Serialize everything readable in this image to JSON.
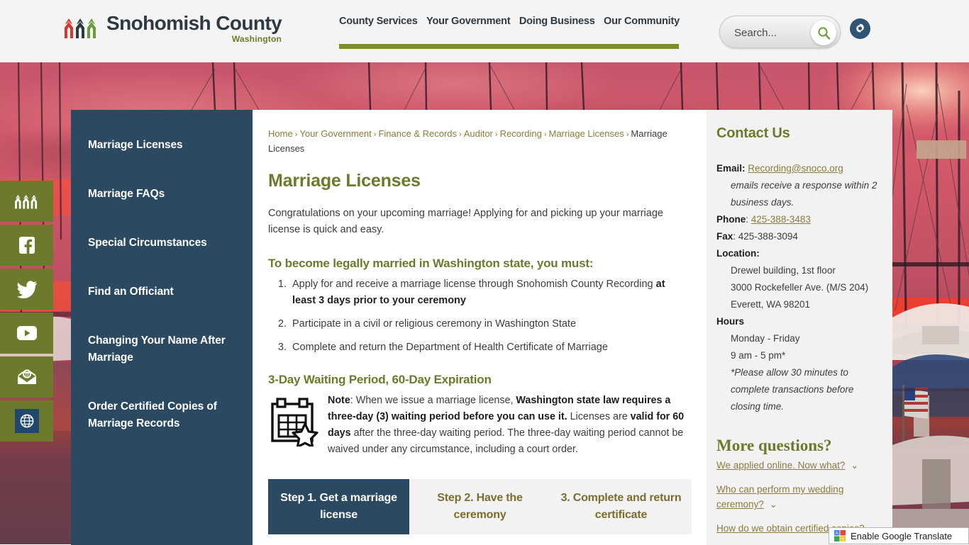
{
  "header": {
    "logo": {
      "title": "Snohomish County",
      "subtitle": "Washington",
      "mark_icon": "three-mountains-logo-icon"
    },
    "nav": [
      {
        "label": "County Services"
      },
      {
        "label": "Your Government"
      },
      {
        "label": "Doing Business"
      },
      {
        "label": "Our Community"
      }
    ],
    "search": {
      "placeholder": "Search...",
      "value": "",
      "icon": "search-icon"
    },
    "settings_icon": "gear-icon",
    "accent_green": "#7d9024"
  },
  "social_rail": [
    {
      "name": "county-logo",
      "icon": "three-mountains-logo-icon"
    },
    {
      "name": "facebook",
      "icon": "facebook-icon"
    },
    {
      "name": "twitter",
      "icon": "twitter-icon"
    },
    {
      "name": "youtube",
      "icon": "youtube-icon"
    },
    {
      "name": "email",
      "icon": "email-envelope-icon"
    },
    {
      "name": "globe",
      "icon": "globe-icon"
    }
  ],
  "sidebar": {
    "items": [
      {
        "label": "Marriage Licenses"
      },
      {
        "label": "Marriage FAQs"
      },
      {
        "label": "Special Circumstances"
      },
      {
        "label": "Find an Officiant"
      },
      {
        "label": "Changing Your Name After Marriage"
      },
      {
        "label": "Order Certified Copies of Marriage Records"
      }
    ],
    "bg_color": "#2b4a61"
  },
  "breadcrumb": {
    "links": [
      "Home",
      "Your Government",
      "Finance & Records",
      "Auditor",
      "Recording",
      "Marriage Licenses"
    ],
    "current": "Marriage Licenses",
    "separator": "›"
  },
  "main": {
    "title": "Marriage Licenses",
    "intro": "Congratulations on your upcoming marriage! Applying for and picking up your marriage license is quick and easy.",
    "requirements_heading": "To become legally married in Washington state, you must:",
    "requirements": [
      {
        "text_before": "Apply for and receive a marriage license through Snohomish County Recording ",
        "bold": "at least 3 days prior to your ceremony",
        "text_after": ""
      },
      {
        "text_before": "Participate in a civil or religious ceremony in Washington State",
        "bold": "",
        "text_after": ""
      },
      {
        "text_before": "Complete and return the Department of Health Certificate of Marriage",
        "bold": "",
        "text_after": ""
      }
    ],
    "waiting_heading": "3-Day Waiting Period, 60-Day Expiration",
    "calendar_icon": "calendar-star-icon",
    "note": {
      "label": "Note",
      "p1": ": When we issue a marriage license, ",
      "b1": "Washington state law requires a three-day (3) waiting period before you can use it.",
      "p2": " Licenses are ",
      "b2": "valid for 60 days",
      "p3": " after the three-day waiting period. The three-day waiting period cannot be waived under any circumstance, including a court order."
    },
    "steps": [
      {
        "label": "Step 1. Get a marriage license",
        "active": true
      },
      {
        "label": "Step 2. Have the ceremony",
        "active": false
      },
      {
        "label": "3. Complete and return certificate",
        "active": false
      }
    ]
  },
  "contact": {
    "title": "Contact Us",
    "email_label": "Email:",
    "email_value": "Recording@snoco.org",
    "email_note": "emails receive a response within 2 business days.",
    "phone_label": "Phone",
    "phone_value": "425-388-3483",
    "fax_label": "Fax",
    "fax_value": "425-388-3094",
    "location_label": "Location:",
    "location_line1": "Drewel building, 1st floor",
    "location_line2": "3000 Rockefeller Ave. (M/S 204)",
    "location_line3": "Everett, WA 98201",
    "hours_label": "Hours",
    "hours_days": "Monday - Friday",
    "hours_time": "9 am - 5 pm*",
    "hours_note": "*Please allow 30 minutes to complete transactions before closing time."
  },
  "more_questions": {
    "title": "More questions?",
    "links": [
      {
        "label": "We applied online. Now what?",
        "icon": "chevron-down-icon"
      },
      {
        "label": "Who can perform my wedding ceremony?",
        "icon": "chevron-down-icon"
      },
      {
        "label": "How do we obtain certified copies?",
        "icon": "chevron-down-icon"
      }
    ]
  },
  "google_translate": {
    "label": "Enable Google Translate",
    "icon": "google-translate-icon"
  }
}
